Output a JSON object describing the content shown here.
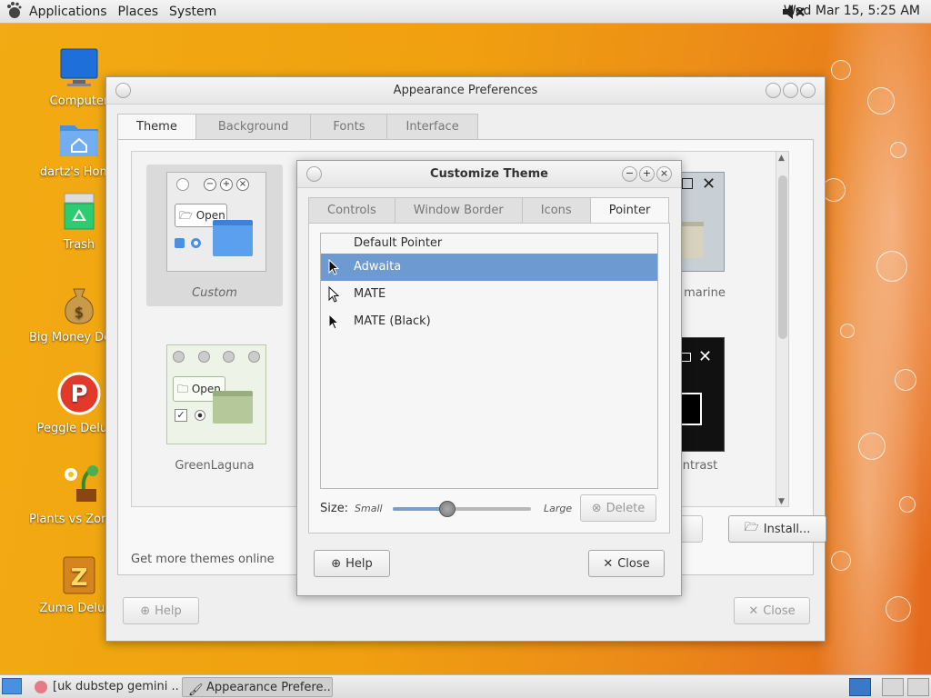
{
  "top_panel": {
    "menus": [
      "Applications",
      "Places",
      "System"
    ],
    "clock": "Wed Mar 15,  5:25 AM"
  },
  "desktop_icons": [
    {
      "label": "Computer",
      "icon": "computer-icon"
    },
    {
      "label": "dartz's Home",
      "icon": "home-folder-icon"
    },
    {
      "label": "Trash",
      "icon": "trash-icon"
    },
    {
      "label": "Big Money Deluxe",
      "icon": "money-bag-icon"
    },
    {
      "label": "Peggle Deluxe",
      "icon": "peggle-icon"
    },
    {
      "label": "Plants vs Zombies",
      "icon": "plants-icon"
    },
    {
      "label": "Zuma Deluxe",
      "icon": "zuma-icon"
    }
  ],
  "appearance": {
    "title": "Appearance Preferences",
    "tabs": [
      "Theme",
      "Background",
      "Fonts",
      "Interface"
    ],
    "active_tab": "Theme",
    "themes": [
      {
        "name": "Custom"
      },
      {
        "name": "marine"
      },
      {
        "name": "GreenLaguna"
      },
      {
        "name": "ntrast"
      }
    ],
    "preview_open_label": "Open",
    "more_themes_link": "Get more themes online",
    "install_button": "Install...",
    "help_button": "Help",
    "close_button": "Close"
  },
  "customize": {
    "title": "Customize Theme",
    "tabs": [
      "Controls",
      "Window Border",
      "Icons",
      "Pointer"
    ],
    "active_tab": "Pointer",
    "pointer_list": [
      {
        "name": "Default Pointer",
        "selected": false
      },
      {
        "name": "Adwaita",
        "selected": true
      },
      {
        "name": "MATE",
        "selected": false
      },
      {
        "name": "MATE (Black)",
        "selected": false
      }
    ],
    "size_label": "Size:",
    "size_small": "Small",
    "size_large": "Large",
    "size_value": 0.38,
    "delete_button": "Delete",
    "help_button": "Help",
    "close_button": "Close"
  },
  "taskbar": {
    "tasks": [
      "[uk dubstep gemini ...",
      "Appearance Prefere..."
    ]
  },
  "colors": {
    "selection": "#6d9ad0",
    "accent_orange": "#f0a010"
  }
}
